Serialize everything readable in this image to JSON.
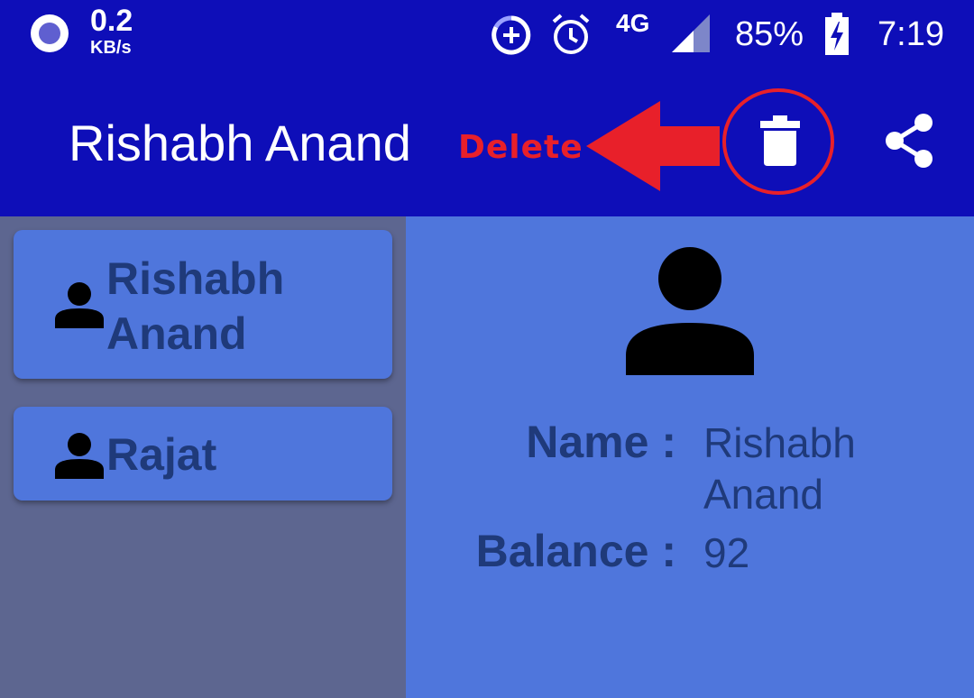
{
  "status_bar": {
    "speed_value": "0.2",
    "speed_unit": "KB/s",
    "network": "4G",
    "battery": "85%",
    "time": "7:19"
  },
  "app_bar": {
    "title": "Rishabh Anand"
  },
  "annotation": {
    "label": "Delete",
    "color": "#e8202a"
  },
  "contacts": [
    {
      "line1": "Rishabh",
      "line2": "Anand"
    },
    {
      "line1": "Rajat"
    }
  ],
  "detail": {
    "name_label": "Name :",
    "name_value_line1": "Rishabh",
    "name_value_line2": "Anand",
    "balance_label": "Balance :",
    "balance_value": "92"
  },
  "colors": {
    "app_bar": "#0e0eb8",
    "card": "#4f76dc",
    "sidebar": "#5d6690",
    "text": "#1f3a7a"
  }
}
